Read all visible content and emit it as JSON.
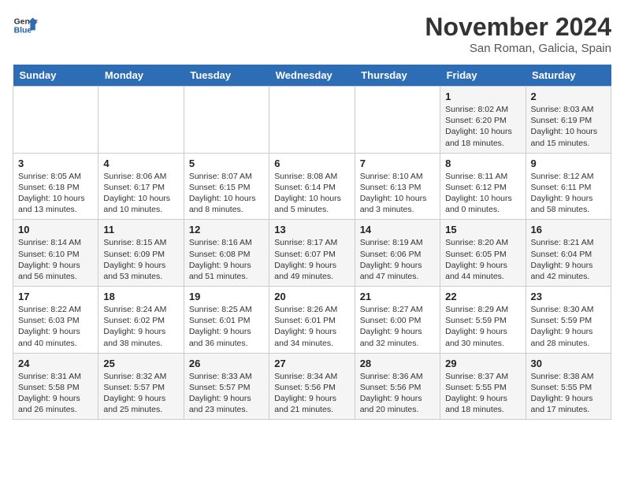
{
  "header": {
    "logo_general": "General",
    "logo_blue": "Blue",
    "month": "November 2024",
    "location": "San Roman, Galicia, Spain"
  },
  "days_of_week": [
    "Sunday",
    "Monday",
    "Tuesday",
    "Wednesday",
    "Thursday",
    "Friday",
    "Saturday"
  ],
  "weeks": [
    [
      {
        "day": "",
        "info": ""
      },
      {
        "day": "",
        "info": ""
      },
      {
        "day": "",
        "info": ""
      },
      {
        "day": "",
        "info": ""
      },
      {
        "day": "",
        "info": ""
      },
      {
        "day": "1",
        "info": "Sunrise: 8:02 AM\nSunset: 6:20 PM\nDaylight: 10 hours and 18 minutes."
      },
      {
        "day": "2",
        "info": "Sunrise: 8:03 AM\nSunset: 6:19 PM\nDaylight: 10 hours and 15 minutes."
      }
    ],
    [
      {
        "day": "3",
        "info": "Sunrise: 8:05 AM\nSunset: 6:18 PM\nDaylight: 10 hours and 13 minutes."
      },
      {
        "day": "4",
        "info": "Sunrise: 8:06 AM\nSunset: 6:17 PM\nDaylight: 10 hours and 10 minutes."
      },
      {
        "day": "5",
        "info": "Sunrise: 8:07 AM\nSunset: 6:15 PM\nDaylight: 10 hours and 8 minutes."
      },
      {
        "day": "6",
        "info": "Sunrise: 8:08 AM\nSunset: 6:14 PM\nDaylight: 10 hours and 5 minutes."
      },
      {
        "day": "7",
        "info": "Sunrise: 8:10 AM\nSunset: 6:13 PM\nDaylight: 10 hours and 3 minutes."
      },
      {
        "day": "8",
        "info": "Sunrise: 8:11 AM\nSunset: 6:12 PM\nDaylight: 10 hours and 0 minutes."
      },
      {
        "day": "9",
        "info": "Sunrise: 8:12 AM\nSunset: 6:11 PM\nDaylight: 9 hours and 58 minutes."
      }
    ],
    [
      {
        "day": "10",
        "info": "Sunrise: 8:14 AM\nSunset: 6:10 PM\nDaylight: 9 hours and 56 minutes."
      },
      {
        "day": "11",
        "info": "Sunrise: 8:15 AM\nSunset: 6:09 PM\nDaylight: 9 hours and 53 minutes."
      },
      {
        "day": "12",
        "info": "Sunrise: 8:16 AM\nSunset: 6:08 PM\nDaylight: 9 hours and 51 minutes."
      },
      {
        "day": "13",
        "info": "Sunrise: 8:17 AM\nSunset: 6:07 PM\nDaylight: 9 hours and 49 minutes."
      },
      {
        "day": "14",
        "info": "Sunrise: 8:19 AM\nSunset: 6:06 PM\nDaylight: 9 hours and 47 minutes."
      },
      {
        "day": "15",
        "info": "Sunrise: 8:20 AM\nSunset: 6:05 PM\nDaylight: 9 hours and 44 minutes."
      },
      {
        "day": "16",
        "info": "Sunrise: 8:21 AM\nSunset: 6:04 PM\nDaylight: 9 hours and 42 minutes."
      }
    ],
    [
      {
        "day": "17",
        "info": "Sunrise: 8:22 AM\nSunset: 6:03 PM\nDaylight: 9 hours and 40 minutes."
      },
      {
        "day": "18",
        "info": "Sunrise: 8:24 AM\nSunset: 6:02 PM\nDaylight: 9 hours and 38 minutes."
      },
      {
        "day": "19",
        "info": "Sunrise: 8:25 AM\nSunset: 6:01 PM\nDaylight: 9 hours and 36 minutes."
      },
      {
        "day": "20",
        "info": "Sunrise: 8:26 AM\nSunset: 6:01 PM\nDaylight: 9 hours and 34 minutes."
      },
      {
        "day": "21",
        "info": "Sunrise: 8:27 AM\nSunset: 6:00 PM\nDaylight: 9 hours and 32 minutes."
      },
      {
        "day": "22",
        "info": "Sunrise: 8:29 AM\nSunset: 5:59 PM\nDaylight: 9 hours and 30 minutes."
      },
      {
        "day": "23",
        "info": "Sunrise: 8:30 AM\nSunset: 5:59 PM\nDaylight: 9 hours and 28 minutes."
      }
    ],
    [
      {
        "day": "24",
        "info": "Sunrise: 8:31 AM\nSunset: 5:58 PM\nDaylight: 9 hours and 26 minutes."
      },
      {
        "day": "25",
        "info": "Sunrise: 8:32 AM\nSunset: 5:57 PM\nDaylight: 9 hours and 25 minutes."
      },
      {
        "day": "26",
        "info": "Sunrise: 8:33 AM\nSunset: 5:57 PM\nDaylight: 9 hours and 23 minutes."
      },
      {
        "day": "27",
        "info": "Sunrise: 8:34 AM\nSunset: 5:56 PM\nDaylight: 9 hours and 21 minutes."
      },
      {
        "day": "28",
        "info": "Sunrise: 8:36 AM\nSunset: 5:56 PM\nDaylight: 9 hours and 20 minutes."
      },
      {
        "day": "29",
        "info": "Sunrise: 8:37 AM\nSunset: 5:55 PM\nDaylight: 9 hours and 18 minutes."
      },
      {
        "day": "30",
        "info": "Sunrise: 8:38 AM\nSunset: 5:55 PM\nDaylight: 9 hours and 17 minutes."
      }
    ]
  ]
}
